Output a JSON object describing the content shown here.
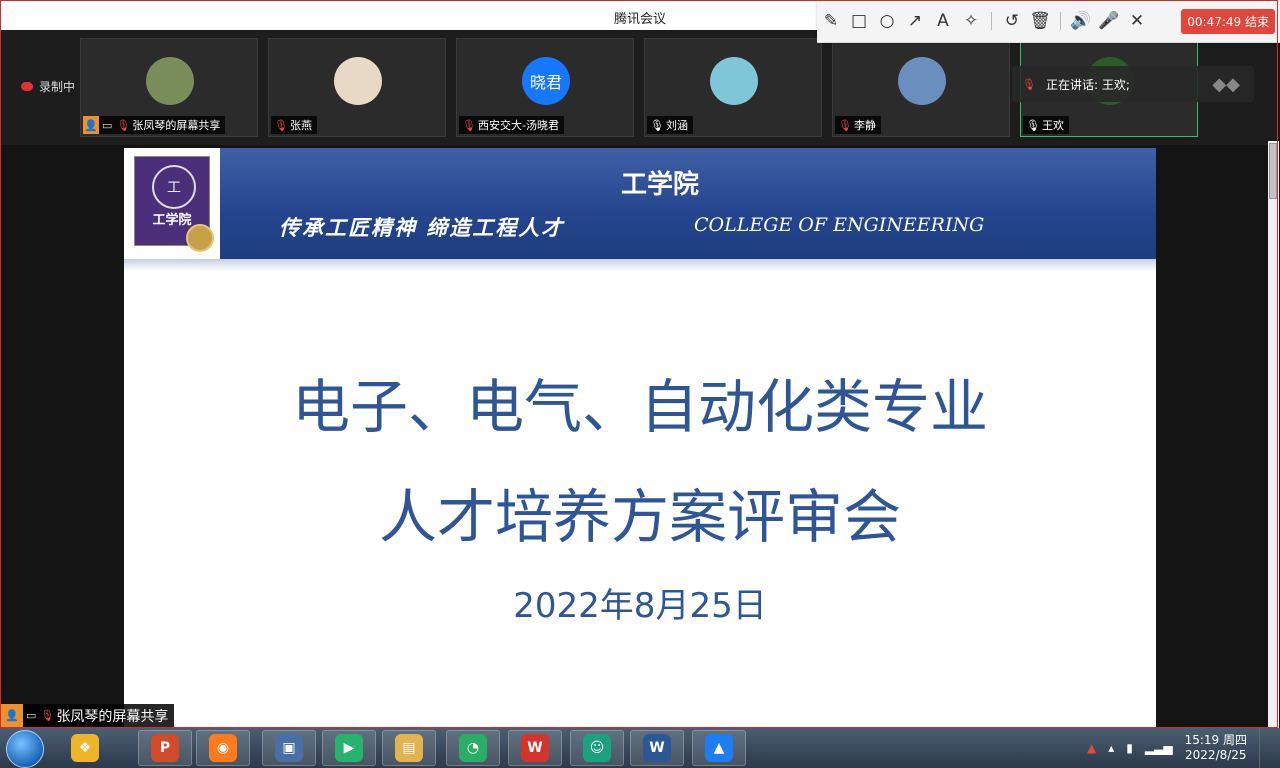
{
  "window": {
    "title": "腾讯会议"
  },
  "annotation_toolbar": {
    "tools": [
      {
        "name": "pen-icon",
        "glyph": "✎"
      },
      {
        "name": "rectangle-icon",
        "glyph": "□"
      },
      {
        "name": "circle-icon",
        "glyph": "○"
      },
      {
        "name": "arrow-icon",
        "glyph": "↗"
      },
      {
        "name": "text-icon",
        "glyph": "A"
      },
      {
        "name": "magic-wand-icon",
        "glyph": "✧"
      },
      {
        "name": "undo-icon",
        "glyph": "↺"
      },
      {
        "name": "trash-icon",
        "glyph": "🗑"
      },
      {
        "name": "speaker-icon",
        "glyph": "🔊"
      },
      {
        "name": "microphone-icon",
        "glyph": "🎤"
      },
      {
        "name": "close-icon",
        "glyph": "✕"
      }
    ],
    "end_label": "00:47:49 结束"
  },
  "recording": {
    "label": "录制中"
  },
  "participants": [
    {
      "name": "张凤琴的屏幕共享",
      "avatar_color": "#7a8e5c",
      "muted": true,
      "sharing": true
    },
    {
      "name": "张燕",
      "avatar_color": "#e8d9c6",
      "muted": true
    },
    {
      "name": "西安交大-汤晓君",
      "avatar_text": "晓君",
      "avatar_color": "#1677ff",
      "muted": true
    },
    {
      "name": "刘涵",
      "avatar_color": "#7ec6d8",
      "muted": false
    },
    {
      "name": "李静",
      "avatar_color": "#6a8fbf",
      "muted": true
    },
    {
      "name": "王欢",
      "avatar_color": "#2e5a2a",
      "muted": false,
      "active": true
    }
  ],
  "speaking": {
    "label": "正在讲话: 王欢;"
  },
  "slide": {
    "logo_text": "工学院",
    "banner_title": "工学院",
    "slogan": "传承工匠精神 缔造工程人才",
    "english": "COLLEGE OF ENGINEERING",
    "line1": "电子、电气、自动化类专业",
    "line2": "人才培养方案评审会",
    "date": "2022年8月25日"
  },
  "share_tag": {
    "label": "张凤琴的屏幕共享"
  },
  "taskbar": {
    "apps": [
      {
        "name": "photos-app",
        "color": "#f0b429",
        "glyph": "❖"
      },
      {
        "name": "powerpoint-app",
        "color": "#d04b2a",
        "glyph": "P"
      },
      {
        "name": "firefox-app",
        "color": "#ff7a1a",
        "glyph": "◉"
      },
      {
        "name": "video-app",
        "color": "#4a6fa5",
        "glyph": "▣"
      },
      {
        "name": "player-app",
        "color": "#26b36b",
        "glyph": "▶"
      },
      {
        "name": "explorer-app",
        "color": "#e2b450",
        "glyph": "▤"
      },
      {
        "name": "wechat-app",
        "color": "#2aae67",
        "glyph": "◔"
      },
      {
        "name": "wps-app",
        "color": "#d6332c",
        "glyph": "W"
      },
      {
        "name": "meeting-app",
        "color": "#1aa27c",
        "glyph": "☺"
      },
      {
        "name": "word-app",
        "color": "#2b5797",
        "glyph": "W"
      },
      {
        "name": "tencent-meeting-app",
        "color": "#1c7ef0",
        "glyph": "▲"
      }
    ],
    "clock_time": "15:19 周四",
    "clock_date": "2022/8/25"
  }
}
